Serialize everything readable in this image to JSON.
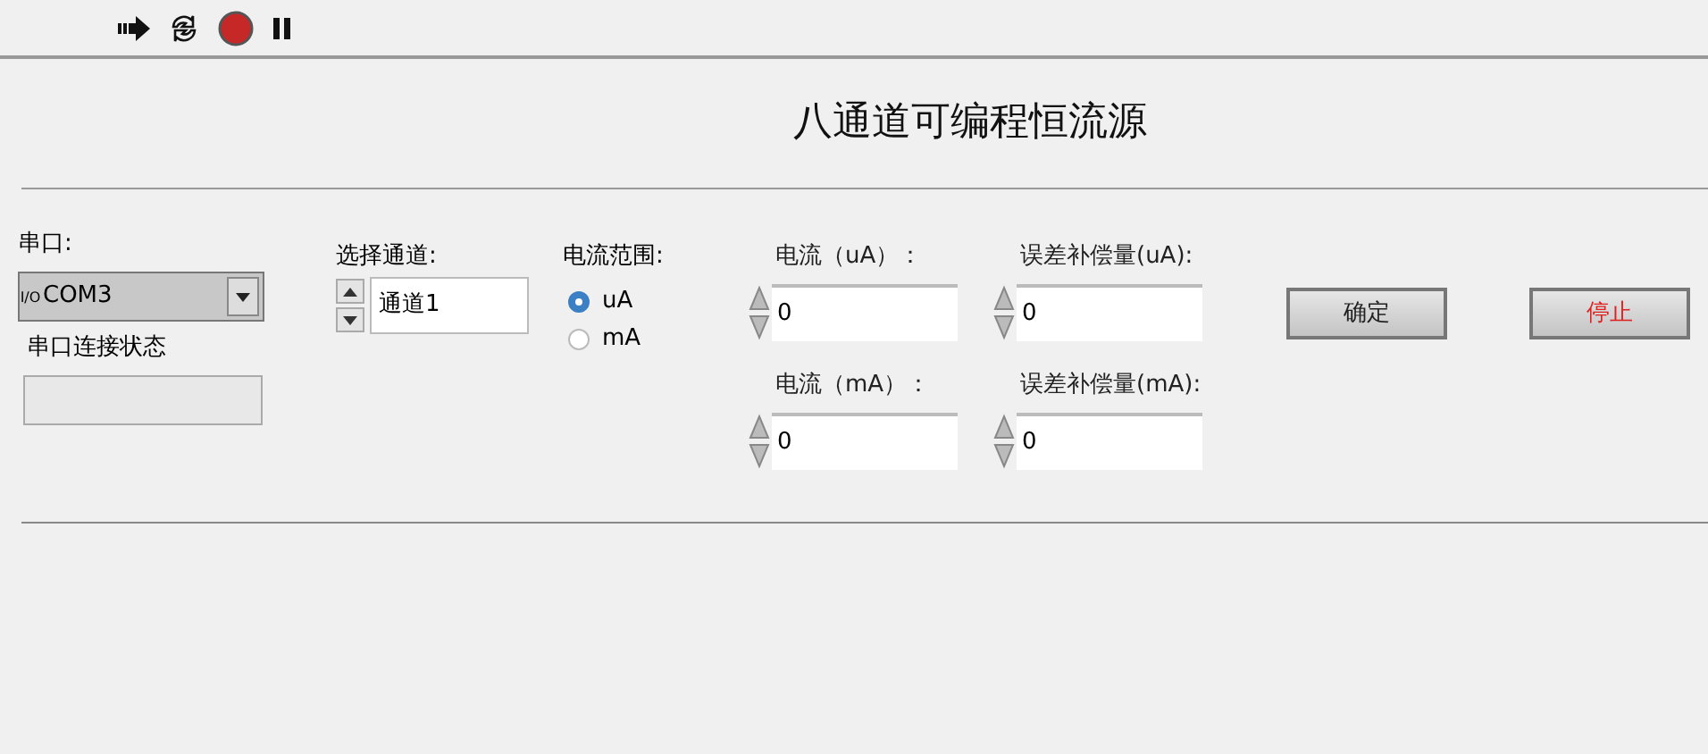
{
  "toolbar": [
    {
      "kind": "run"
    },
    {
      "kind": "run_continuous"
    },
    {
      "kind": "abort"
    },
    {
      "kind": "pause"
    }
  ],
  "title": "八通道可编程恒流源",
  "serial_port": {
    "label": "串口:",
    "io_mark": "I/O",
    "value": "COM3",
    "status_label": "串口连接状态"
  },
  "channel": {
    "label": "选择通道:",
    "value": "通道1"
  },
  "current_range": {
    "label": "电流范围:",
    "options": [
      {
        "label": "uA",
        "selected": true
      },
      {
        "label": "mA",
        "selected": false
      }
    ]
  },
  "numeric_fields": [
    {
      "label": "电流（uA）：",
      "value": "0"
    },
    {
      "label": "误差补偿量(uA):",
      "value": "0"
    },
    {
      "label": "电流（mA）：",
      "value": "0"
    },
    {
      "label": "误差补偿量(mA):",
      "value": "0"
    }
  ],
  "buttons": [
    {
      "label": "确定",
      "kind": "confirm"
    },
    {
      "label": "停止",
      "kind": "stop"
    }
  ]
}
